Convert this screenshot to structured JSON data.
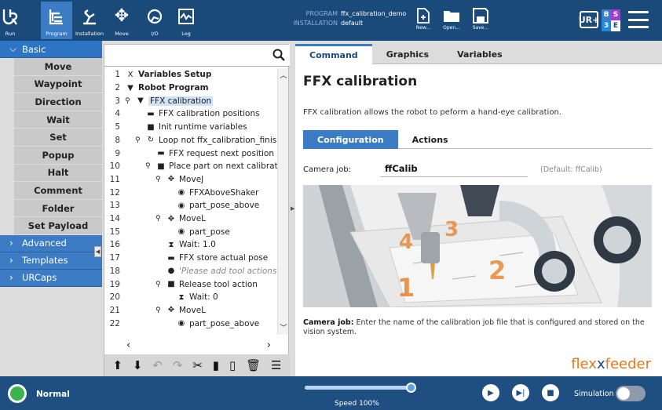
{
  "topbar": {
    "tabs": [
      {
        "label": "Run",
        "icon": "ur-logo-icon"
      },
      {
        "label": "Program",
        "icon": "program-icon"
      },
      {
        "label": "Installation",
        "icon": "installation-icon"
      },
      {
        "label": "Move",
        "icon": "move-icon"
      },
      {
        "label": "I/O",
        "icon": "io-icon"
      },
      {
        "label": "Log",
        "icon": "log-icon"
      }
    ],
    "program_key": "PROGRAM",
    "program_value": "ffx_calibration_demo",
    "installation_key": "INSTALLATION",
    "installation_value": "default",
    "file_buttons": [
      {
        "label": "New...",
        "icon": "new-file-icon"
      },
      {
        "label": "Open...",
        "icon": "open-folder-icon"
      },
      {
        "label": "Save...",
        "icon": "save-icon"
      }
    ],
    "urplus_label": "UR+",
    "modes": [
      "B",
      "S",
      "3",
      "E"
    ],
    "mode_colors": [
      "#3b7cc4",
      "#a23ad6",
      "#1e88e5",
      "#ffffff"
    ]
  },
  "leftnav": {
    "basic_label": "Basic",
    "basic_items": [
      "Move",
      "Waypoint",
      "Direction",
      "Wait",
      "Set",
      "Popup",
      "Halt",
      "Comment",
      "Folder",
      "Set Payload"
    ],
    "other_categories": [
      "Advanced",
      "Templates",
      "URCaps"
    ]
  },
  "tree": {
    "search_placeholder": "",
    "rows": [
      {
        "n": "1",
        "icon": "X",
        "text": "Variables Setup",
        "indent": 0,
        "bold": true
      },
      {
        "n": "2",
        "icon": "▼",
        "text": "Robot Program",
        "indent": 0,
        "bold": true
      },
      {
        "n": "3",
        "icon": "▼",
        "text": "FFX calibration",
        "indent": 1,
        "sel": true,
        "pin": true
      },
      {
        "n": "4",
        "icon": "▬",
        "text": "FFX calibration positions",
        "indent": 2
      },
      {
        "n": "5",
        "icon": "■",
        "text": "Init runtime variables",
        "indent": 2
      },
      {
        "n": "8",
        "icon": "↻",
        "text": "Loop not ffx_calibration_finish",
        "indent": 2,
        "pin": true
      },
      {
        "n": "9",
        "icon": "▬",
        "text": "FFX request next position",
        "indent": 3
      },
      {
        "n": "10",
        "icon": "■",
        "text": "Place part on next calibratic",
        "indent": 3,
        "pin": true
      },
      {
        "n": "11",
        "icon": "✥",
        "text": "MoveJ",
        "indent": 4,
        "pin": true
      },
      {
        "n": "12",
        "icon": "◉",
        "text": "FFXAboveShaker",
        "indent": 5
      },
      {
        "n": "13",
        "icon": "◉",
        "text": "part_pose_above",
        "indent": 5
      },
      {
        "n": "14",
        "icon": "✥",
        "text": "MoveL",
        "indent": 4,
        "pin": true
      },
      {
        "n": "15",
        "icon": "◉",
        "text": "part_pose",
        "indent": 5
      },
      {
        "n": "16",
        "icon": "⧗",
        "text": "Wait: 1.0",
        "indent": 4
      },
      {
        "n": "17",
        "icon": "▬",
        "text": "FFX store actual pose",
        "indent": 4
      },
      {
        "n": "18",
        "icon": "●",
        "text": "'Please add tool actions t",
        "indent": 4,
        "grey": true
      },
      {
        "n": "19",
        "icon": "■",
        "text": "Release tool action",
        "indent": 4,
        "pin": true
      },
      {
        "n": "20",
        "icon": "⧗",
        "text": "Wait: 0",
        "indent": 5
      },
      {
        "n": "21",
        "icon": "✥",
        "text": "MoveL",
        "indent": 4,
        "pin": true
      },
      {
        "n": "22",
        "icon": "◉",
        "text": "part_pose_above",
        "indent": 5
      }
    ],
    "toolbar_icons": [
      "move-up-icon",
      "move-down-icon",
      "undo-icon",
      "redo-icon",
      "cut-icon",
      "copy-icon",
      "paste-icon",
      "delete-icon",
      "suppress-icon"
    ]
  },
  "main": {
    "tabs": [
      "Command",
      "Graphics",
      "Variables"
    ],
    "title": "FFX calibration",
    "description": "FFX calibration allows the robot to peform a hand-eye calibration.",
    "subtabs": [
      "Configuration",
      "Actions"
    ],
    "camera_job_label": "Camera job:",
    "camera_job_value": "ffCalib",
    "camera_job_default": "(Default: ffCalib)",
    "help_bold": "Camera job:",
    "help_text": " Enter the name of the calibration job file that is configured and stored on the vision system.",
    "brand_a": "flex",
    "brand_x": "x",
    "brand_b": "feeder",
    "illustration_labels": [
      "4",
      "3",
      "1",
      "2"
    ]
  },
  "bottombar": {
    "status": "Normal",
    "speed_label": "Speed 100%",
    "speed_fraction": 1.0,
    "simulation_label": "Simulation",
    "simulation_on": false
  }
}
